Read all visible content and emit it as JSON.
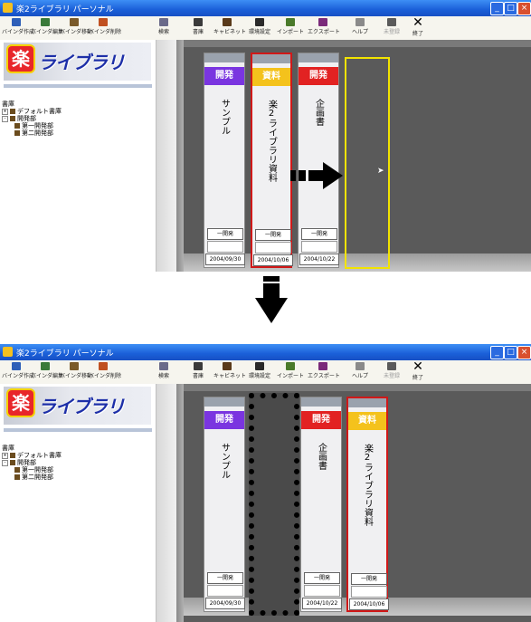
{
  "window": {
    "title": "楽2ライブラリ パーソナル",
    "controls": [
      "_",
      "□",
      "×"
    ]
  },
  "toolbar": {
    "buttons": [
      {
        "label": "バインダ作成"
      },
      {
        "label": "バインダ編集"
      },
      {
        "label": "バインダ移動"
      },
      {
        "label": "バインダ削除"
      },
      {
        "label": "検索"
      },
      {
        "label": "書庫"
      },
      {
        "label": "キャビネット"
      },
      {
        "label": "環境設定"
      },
      {
        "label": "インポート"
      },
      {
        "label": "エクスポート"
      },
      {
        "label": "ヘルプ"
      },
      {
        "label": "未登録"
      },
      {
        "label": "終了"
      }
    ]
  },
  "logo": {
    "mark": "楽",
    "text": "ライブラリ"
  },
  "tree": {
    "root": "書庫",
    "items": [
      "デフォルト書庫",
      "開発部",
      "第一開発部",
      "第二開発部"
    ]
  },
  "before": {
    "books": [
      {
        "category": "開発",
        "title": "サンプル",
        "dept": "一開発",
        "date": "2004/09/30",
        "color": "#7a35e0"
      },
      {
        "category": "資料",
        "title": "楽2ライブラリ資料",
        "dept": "一開発",
        "date": "2004/10/06",
        "color": "#f4c21c"
      },
      {
        "category": "開発",
        "title": "企画書",
        "dept": "一開発",
        "date": "2004/10/22",
        "color": "#e22222"
      }
    ]
  },
  "after": {
    "books": [
      {
        "category": "開発",
        "title": "サンプル",
        "dept": "一開発",
        "date": "2004/09/30",
        "color": "#7a35e0"
      },
      {
        "category": "開発",
        "title": "企画書",
        "dept": "一開発",
        "date": "2004/10/22",
        "color": "#e22222"
      },
      {
        "category": "資料",
        "title": "楽2ライブラリ資料",
        "dept": "一開発",
        "date": "2004/10/06",
        "color": "#f4c21c"
      }
    ]
  }
}
